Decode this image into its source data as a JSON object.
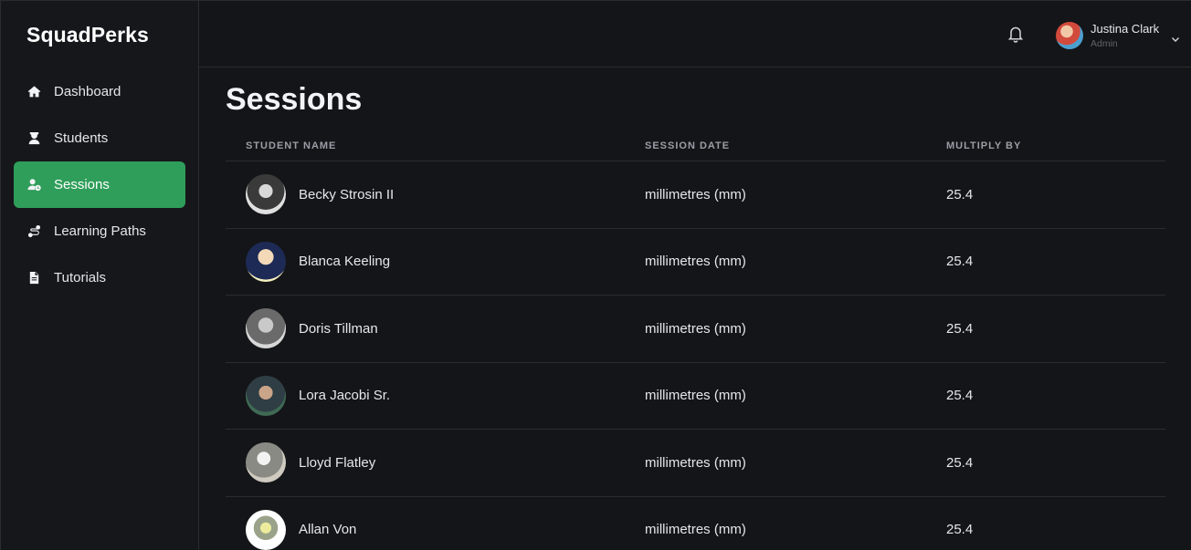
{
  "app": {
    "brand": "SquadPerks"
  },
  "sidebar": {
    "items": [
      {
        "label": "Dashboard",
        "icon": "home-icon",
        "active": false
      },
      {
        "label": "Students",
        "icon": "student-icon",
        "active": false
      },
      {
        "label": "Sessions",
        "icon": "user-clock-icon",
        "active": true
      },
      {
        "label": "Learning Paths",
        "icon": "route-icon",
        "active": false
      },
      {
        "label": "Tutorials",
        "icon": "document-icon",
        "active": false
      }
    ],
    "active_color": "#2f9e5a"
  },
  "header": {
    "notification_icon": "bell-icon",
    "user": {
      "name": "Justina Clark",
      "role": "Admin",
      "menu_icon": "chevron-down-icon"
    }
  },
  "main": {
    "title": "Sessions",
    "table": {
      "columns": [
        "STUDENT NAME",
        "SESSION DATE",
        "MULTIPLY BY"
      ],
      "rows": [
        {
          "name": "Becky Strosin II",
          "session_date": "millimetres (mm)",
          "multiply_by": "25.4"
        },
        {
          "name": "Blanca Keeling",
          "session_date": "millimetres (mm)",
          "multiply_by": "25.4"
        },
        {
          "name": "Doris Tillman",
          "session_date": "millimetres (mm)",
          "multiply_by": "25.4"
        },
        {
          "name": "Lora Jacobi Sr.",
          "session_date": "millimetres (mm)",
          "multiply_by": "25.4"
        },
        {
          "name": "Lloyd Flatley",
          "session_date": "millimetres (mm)",
          "multiply_by": "25.4"
        },
        {
          "name": "Allan Von",
          "session_date": "millimetres (mm)",
          "multiply_by": "25.4"
        }
      ]
    }
  }
}
